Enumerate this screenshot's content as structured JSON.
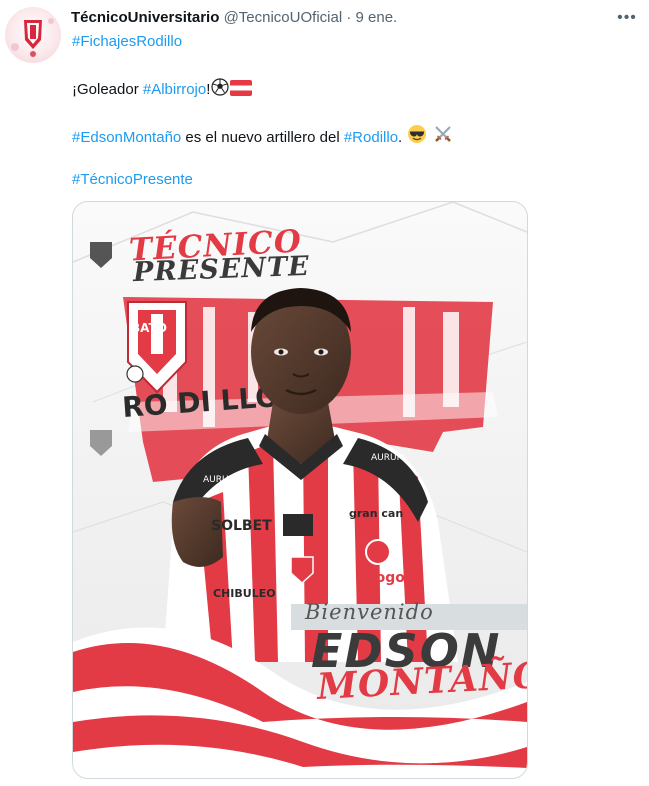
{
  "author": {
    "name": "TécnicoUniversitario",
    "handle": "@TecnicoUOficial",
    "separator": "·",
    "time": "9 ene."
  },
  "more_label": "•••",
  "tweet": {
    "line1_hashtag": "#FichajesRodillo",
    "line2_prefix": "¡Goleador ",
    "line2_hashtag": "#Albirrojo",
    "line2_suffix": "!",
    "line3_hashtag1": "#EdsonMontaño",
    "line3_middle": " es el nuevo artillero del ",
    "line3_hashtag2": "#Rodillo",
    "line3_suffix": ".",
    "line4_hashtag": "#TécnicoPresente"
  },
  "media": {
    "brand_top": "TÉCNICO",
    "brand_bottom": "PRESENTE",
    "welcome": "Bienvenido",
    "first_name": "EDSON",
    "last_name": "MONTAÑO",
    "sponsor_chest": "SOLBET",
    "sponsor_can": "gran can",
    "sponsor_bogo": "Bogo",
    "sponsor_chibuleo": "CHIBULEO",
    "collar_brand": "AURUM",
    "badge_text": "BATO",
    "wall_text": "RO DI LLO"
  },
  "colors": {
    "hashtag": "#1d9bf0",
    "club_red": "#e23b46",
    "muted": "#536471"
  },
  "icons": [
    "more-icon",
    "smiling-sunglasses-emoji",
    "soccer-ball-emoji",
    "austria-flag-emoji",
    "crossed-swords-emoji"
  ]
}
